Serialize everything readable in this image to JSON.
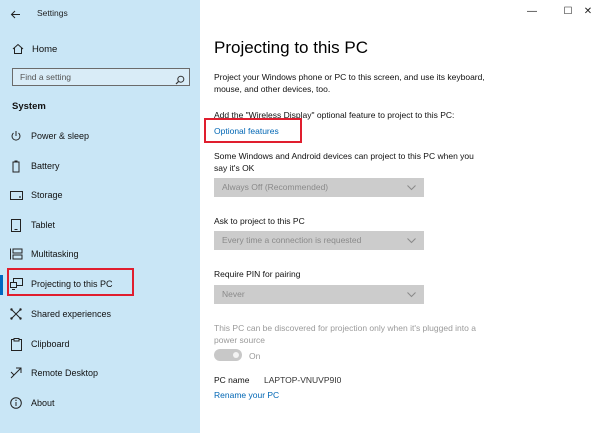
{
  "window": {
    "title": "Settings",
    "controls": {
      "minimize": "—",
      "maximize": "☐",
      "close": "✕"
    }
  },
  "sidebar": {
    "home_label": "Home",
    "search_placeholder": "Find a setting",
    "section_title": "System",
    "items": [
      {
        "label": "Power & sleep",
        "icon": "power-icon"
      },
      {
        "label": "Battery",
        "icon": "battery-icon"
      },
      {
        "label": "Storage",
        "icon": "storage-icon"
      },
      {
        "label": "Tablet",
        "icon": "tablet-icon"
      },
      {
        "label": "Multitasking",
        "icon": "multitasking-icon"
      },
      {
        "label": "Projecting to this PC",
        "icon": "projecting-icon",
        "selected": true
      },
      {
        "label": "Shared experiences",
        "icon": "shared-experiences-icon"
      },
      {
        "label": "Clipboard",
        "icon": "clipboard-icon"
      },
      {
        "label": "Remote Desktop",
        "icon": "remote-desktop-icon"
      },
      {
        "label": "About",
        "icon": "about-icon"
      }
    ]
  },
  "main": {
    "title": "Projecting to this PC",
    "description": "Project your Windows phone or PC to this screen, and use its keyboard, mouse, and other devices, too.",
    "wireless_display_text": "Add the \"Wireless Display\" optional feature to project to this PC:",
    "optional_features_link": "Optional features",
    "some_devices_text": "Some Windows and Android devices can project to this PC when you say it's OK",
    "dropdown1_value": "Always Off (Recommended)",
    "ask_label": "Ask to project to this PC",
    "dropdown2_value": "Every time a connection is requested",
    "pin_label": "Require PIN for pairing",
    "dropdown3_value": "Never",
    "discover_text": "This PC can be discovered for projection only when it's plugged into a power source",
    "toggle_label": "On",
    "toggle_on": true,
    "pc_name_label": "PC name",
    "pc_name_value": "LAPTOP-VNUVP9I0",
    "rename_link": "Rename your PC"
  },
  "colors": {
    "sidebar_bg": "#c9e6f6",
    "accent": "#0067c0",
    "link": "#0066b4",
    "highlight_box": "#e01e2e"
  }
}
